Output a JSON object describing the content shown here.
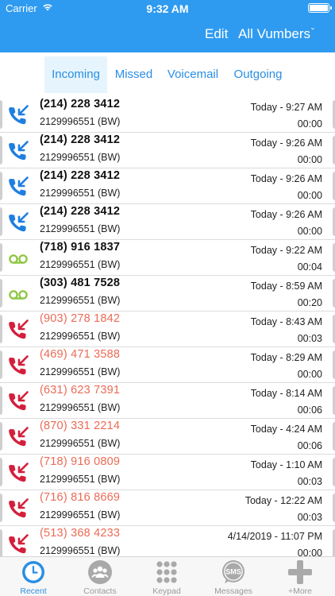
{
  "status_bar": {
    "carrier": "Carrier",
    "time": "9:32 AM"
  },
  "header": {
    "edit_label": "Edit",
    "vumbers_label": "All Vumbers",
    "vumbers_chevron": "ˇ"
  },
  "tabs": [
    {
      "label": "Incoming",
      "active": true
    },
    {
      "label": "Missed",
      "active": false
    },
    {
      "label": "Voicemail",
      "active": false
    },
    {
      "label": "Outgoing",
      "active": false
    }
  ],
  "colors": {
    "header_bg": "#2f9bf0",
    "accent": "#2a8ee3",
    "incoming_icon": "#1f7fe0",
    "voicemail_icon": "#8cc63f",
    "missed_icon": "#d41f3c",
    "missed_text": "#ec6a55"
  },
  "calls": [
    {
      "type": "incoming",
      "number": "(214) 228 3412",
      "line": "2129996551 (BW)",
      "when": "Today - 9:27 AM",
      "duration": "00:00",
      "icon": "incoming-call-icon"
    },
    {
      "type": "incoming",
      "number": "(214) 228 3412",
      "line": "2129996551 (BW)",
      "when": "Today - 9:26 AM",
      "duration": "00:00",
      "icon": "incoming-call-icon"
    },
    {
      "type": "incoming",
      "number": "(214) 228 3412",
      "line": "2129996551 (BW)",
      "when": "Today - 9:26 AM",
      "duration": "00:00",
      "icon": "incoming-call-icon"
    },
    {
      "type": "incoming",
      "number": "(214) 228 3412",
      "line": "2129996551 (BW)",
      "when": "Today - 9:26 AM",
      "duration": "00:00",
      "icon": "incoming-call-icon"
    },
    {
      "type": "voicemail",
      "number": "(718) 916 1837",
      "line": "2129996551 (BW)",
      "when": "Today - 9:22 AM",
      "duration": "00:04",
      "icon": "voicemail-icon"
    },
    {
      "type": "voicemail",
      "number": "(303) 481 7528",
      "line": "2129996551 (BW)",
      "when": "Today - 8:59 AM",
      "duration": "00:20",
      "icon": "voicemail-icon"
    },
    {
      "type": "missed",
      "number": "(903) 278 1842",
      "line": "2129996551 (BW)",
      "when": "Today - 8:43 AM",
      "duration": "00:03",
      "icon": "missed-call-icon"
    },
    {
      "type": "missed",
      "number": "(469) 471 3588",
      "line": "2129996551 (BW)",
      "when": "Today - 8:29 AM",
      "duration": "00:00",
      "icon": "missed-call-icon"
    },
    {
      "type": "missed",
      "number": "(631) 623 7391",
      "line": "2129996551 (BW)",
      "when": "Today - 8:14 AM",
      "duration": "00:06",
      "icon": "missed-call-icon"
    },
    {
      "type": "missed",
      "number": "(870) 331 2214",
      "line": "2129996551 (BW)",
      "when": "Today - 4:24 AM",
      "duration": "00:06",
      "icon": "missed-call-icon"
    },
    {
      "type": "missed",
      "number": "(718) 916 0809",
      "line": "2129996551 (BW)",
      "when": "Today - 1:10 AM",
      "duration": "00:03",
      "icon": "missed-call-icon"
    },
    {
      "type": "missed",
      "number": "(716) 816 8669",
      "line": "2129996551 (BW)",
      "when": "Today - 12:22 AM",
      "duration": "00:03",
      "icon": "missed-call-icon"
    },
    {
      "type": "missed",
      "number": "(513) 368 4233",
      "line": "2129996551 (BW)",
      "when": "4/14/2019 - 11:07 PM",
      "duration": "00:00",
      "icon": "missed-call-icon"
    }
  ],
  "tabbar": [
    {
      "label": "Recent",
      "icon": "clock-icon",
      "active": true
    },
    {
      "label": "Contacts",
      "icon": "contacts-icon",
      "active": false
    },
    {
      "label": "Keypad",
      "icon": "keypad-icon",
      "active": false
    },
    {
      "label": "Messages",
      "icon": "sms-icon",
      "active": false
    },
    {
      "label": "+More",
      "icon": "plus-icon",
      "active": false
    }
  ]
}
